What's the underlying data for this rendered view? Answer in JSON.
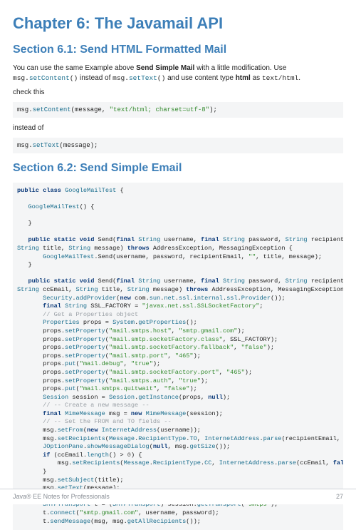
{
  "chapter": {
    "title": "Chapter 6: The Javamail API"
  },
  "section61": {
    "title": "Section 6.1: Send HTML Formatted Mail",
    "para1_a": "You can use the same Example above ",
    "para1_b": "Send Simple Mail",
    "para1_c": " with a little modification. Use ",
    "para1_code1": "msg.setContent()",
    "para1_d": " instead of ",
    "para1_code2": "msg.setText()",
    "para1_e": " and use content type ",
    "para1_f": "html",
    "para1_g": " as ",
    "para1_code3": "text/html",
    "para1_h": ".",
    "check": "check this",
    "instead": "instead of"
  },
  "section62": {
    "title": "Section 6.2: Send Simple Email"
  },
  "footer": {
    "left": "Java® EE Notes for Professionals",
    "right": "27"
  },
  "chart_data": null
}
